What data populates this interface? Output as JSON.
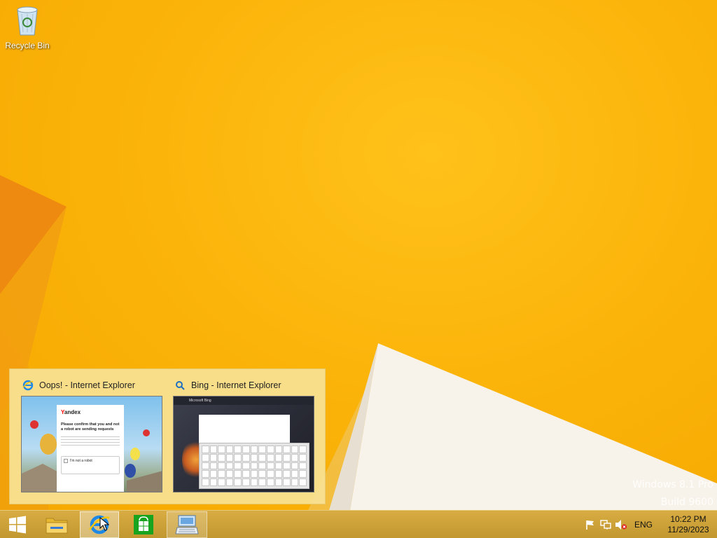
{
  "desktop": {
    "icons": [
      {
        "label": "Recycle Bin",
        "icon": "recycle-bin-icon"
      }
    ],
    "watermark": [
      "Windows 8.1 Pro",
      "Build 9600"
    ]
  },
  "thumbnails": [
    {
      "title": "Oops! - Internet Explorer",
      "icon": "internet-explorer-icon",
      "preview": {
        "logo": "Yandex",
        "message": "Please confirm that you and not a robot are sending requests",
        "checkbox_label": "I'm not a robot"
      }
    },
    {
      "title": "Bing - Internet Explorer",
      "icon": "bing-search-icon",
      "preview": {
        "logo": "Microsoft Bing"
      }
    }
  ],
  "taskbar": {
    "pinned": [
      {
        "name": "file-explorer",
        "icon": "folder-icon"
      },
      {
        "name": "internet-explorer",
        "icon": "internet-explorer-icon",
        "active": true
      },
      {
        "name": "store",
        "icon": "store-icon"
      },
      {
        "name": "on-screen-keyboard",
        "icon": "keyboard-icon",
        "active": true
      }
    ]
  },
  "tray": {
    "language": "ENG",
    "time": "10:22 PM",
    "date": "11/29/2023"
  },
  "colors": {
    "accent": "#f7b700",
    "taskbar": "#c99d3c"
  }
}
